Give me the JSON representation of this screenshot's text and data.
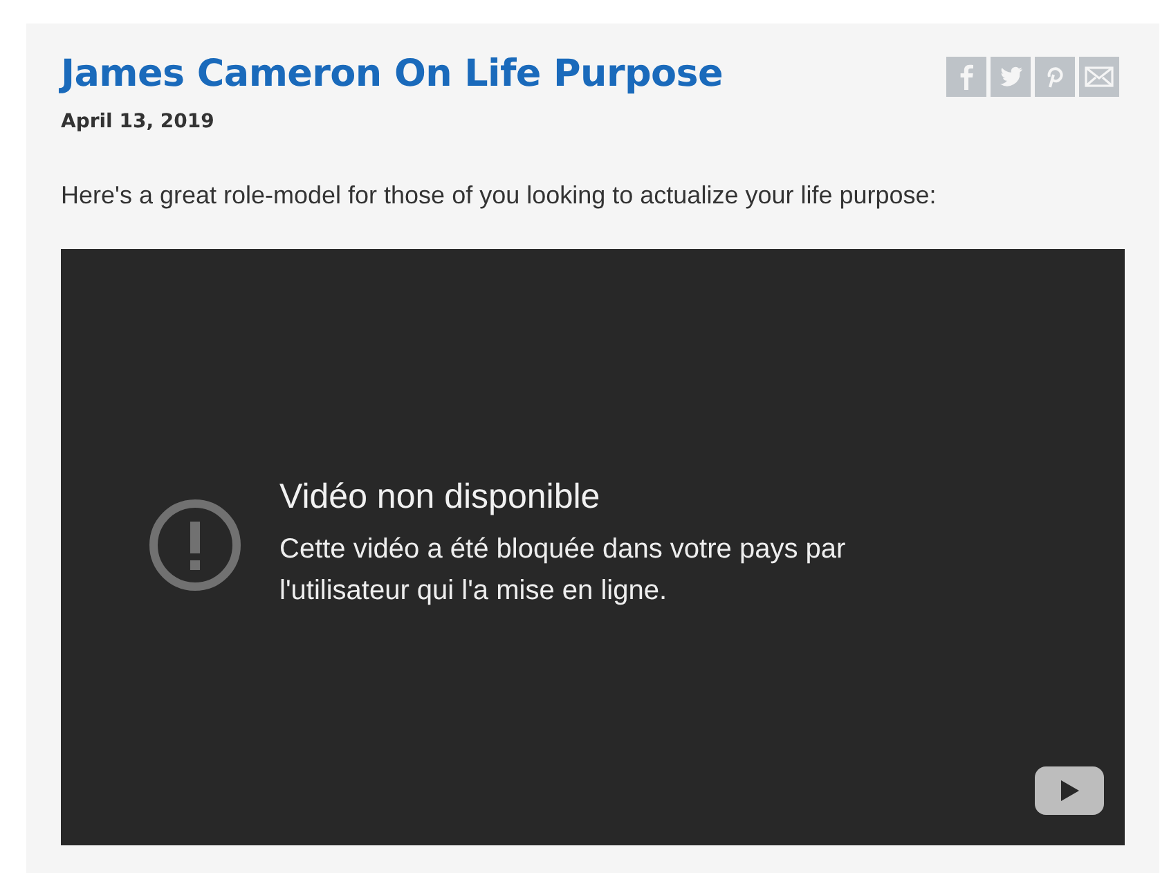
{
  "post": {
    "title": "James Cameron On Life Purpose",
    "date": "April 13, 2019",
    "intro": "Here's a great role-model for those of you looking to actualize your life purpose:"
  },
  "video": {
    "title": "Vidéo non disponible",
    "message": "Cette vidéo a été bloquée dans votre pays par l'utilisateur qui l'a mise en ligne."
  }
}
